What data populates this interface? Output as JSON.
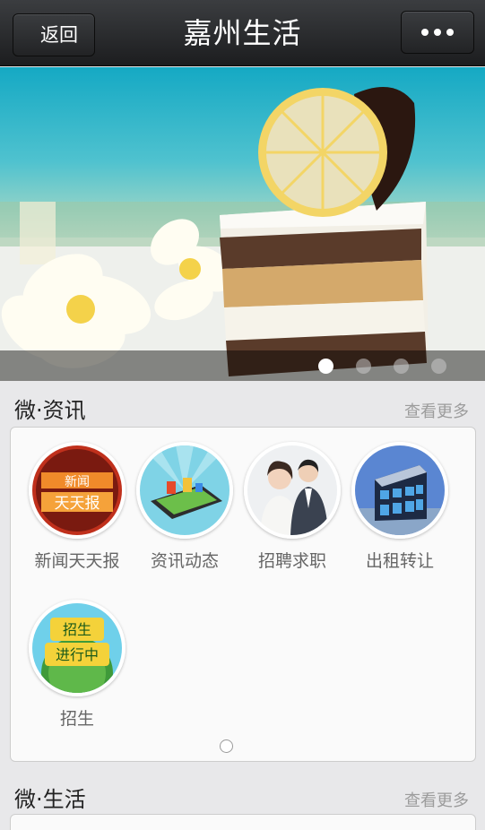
{
  "navbar": {
    "back_label": "返回",
    "title": "嘉州生活",
    "more_icon": "more-dots-icon"
  },
  "banner": {
    "image": "cake-with-lemon-slice-photo",
    "indicators": {
      "count": 4,
      "active_index": 0
    }
  },
  "sections": [
    {
      "title": "微·资讯",
      "more_label": "查看更多",
      "items": [
        {
          "label": "新闻天天报",
          "icon": "news-daily-icon"
        },
        {
          "label": "资讯动态",
          "icon": "phone-city-icon"
        },
        {
          "label": "招聘求职",
          "icon": "job-people-icon"
        },
        {
          "label": "出租转让",
          "icon": "building-icon"
        },
        {
          "label": "招生",
          "icon": "enrollment-globe-icon"
        }
      ]
    },
    {
      "title": "微·生活",
      "more_label": "查看更多"
    }
  ],
  "colors": {
    "navbar": "#1c1d1f",
    "background": "#e8e8ea",
    "card": "#fafafa",
    "more_text": "#9c9c9c"
  }
}
